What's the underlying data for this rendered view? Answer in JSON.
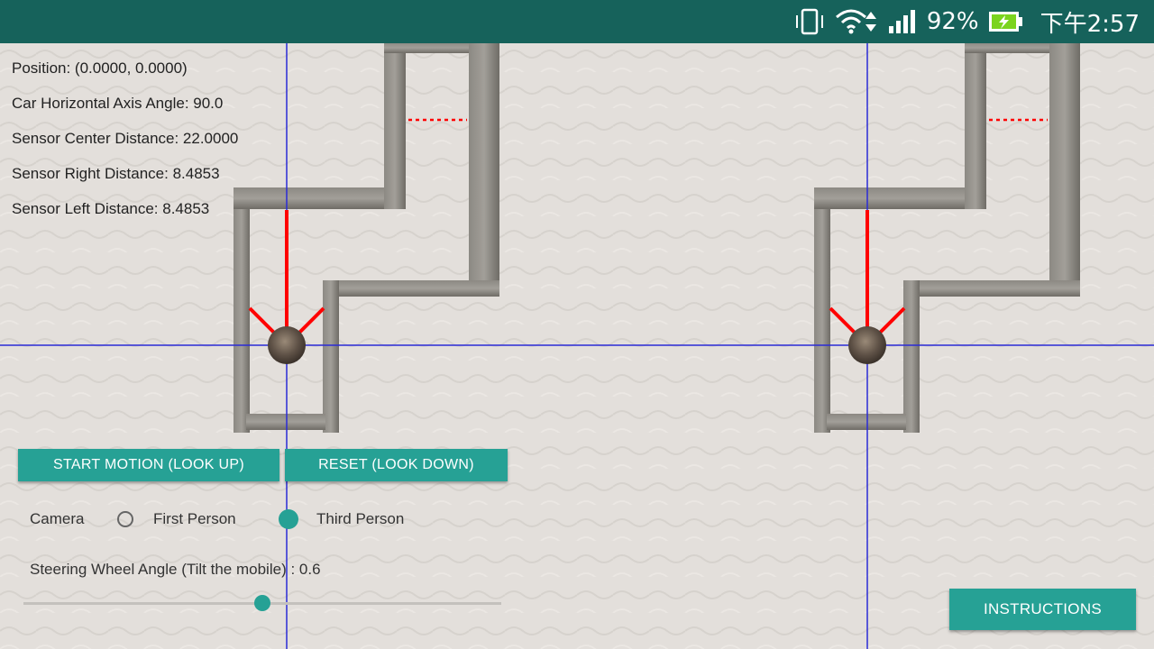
{
  "status_bar": {
    "battery_percent": "92%",
    "time": "下午2:57",
    "icons": [
      "vibrate-icon",
      "wifi-icon",
      "signal-icon",
      "battery-charging-icon"
    ],
    "background_color": "#16625b"
  },
  "readouts": {
    "position": "Position: (0.0000, 0.0000)",
    "car_angle": "Car Horizontal Axis Angle: 90.0",
    "sensor_center": "Sensor Center Distance: 22.0000",
    "sensor_right": "Sensor Right Distance: 8.4853",
    "sensor_left": "Sensor Left Distance: 8.4853"
  },
  "buttons": {
    "start_motion": "START MOTION (LOOK UP)",
    "reset": "RESET (LOOK DOWN)",
    "instructions": "INSTRUCTIONS"
  },
  "camera": {
    "label": "Camera",
    "options": [
      "First Person",
      "Third Person"
    ],
    "selected": "Third Person"
  },
  "steering": {
    "label": "Steering Wheel Angle (Tilt the mobile) : 0.6",
    "slider_fraction": 0.5
  },
  "colors": {
    "accent": "#26a195",
    "sensor_ray": "#ff0000",
    "axis_line": "#2b2bd6",
    "wall": "#7d7a74"
  }
}
